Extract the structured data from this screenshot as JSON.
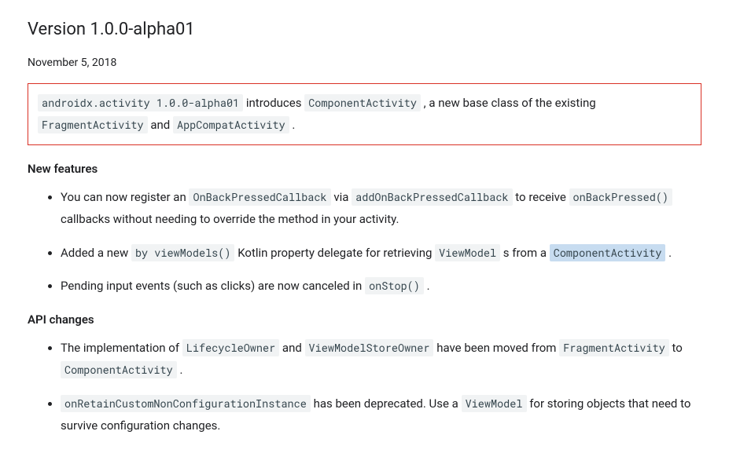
{
  "heading": "Version 1.0.0-alpha01",
  "date": "November 5, 2018",
  "intro": {
    "code1": "androidx.activity 1.0.0-alpha01",
    "text1": " introduces ",
    "code2": "ComponentActivity",
    "text2": " , a new base class of the existing ",
    "code3": "FragmentActivity",
    "text3": " and ",
    "code4": "AppCompatActivity",
    "text4": " ."
  },
  "new_features": {
    "title": "New features",
    "items": [
      {
        "t1": "You can now register an ",
        "c1": "OnBackPressedCallback",
        "t2": " via ",
        "c2": "addOnBackPressedCallback",
        "t3": " to receive ",
        "c3": "onBackPressed()",
        "t4": " callbacks without needing to override the method in your activity."
      },
      {
        "t1": "Added a new ",
        "c1": "by viewModels()",
        "t2": " Kotlin property delegate for retrieving ",
        "c2": "ViewModel",
        "t3": " s from a ",
        "c3": "ComponentActivity",
        "t4": " ."
      },
      {
        "t1": "Pending input events (such as clicks) are now canceled in ",
        "c1": "onStop()",
        "t2": " ."
      }
    ]
  },
  "api_changes": {
    "title": "API changes",
    "items": [
      {
        "t1": "The implementation of ",
        "c1": "LifecycleOwner",
        "t2": " and ",
        "c2": "ViewModelStoreOwner",
        "t3": " have been moved from ",
        "c3": "FragmentActivity",
        "t4": " to ",
        "c4": "ComponentActivity",
        "t5": " ."
      },
      {
        "c1": "onRetainCustomNonConfigurationInstance",
        "t1": " has been deprecated. Use a ",
        "c2": "ViewModel",
        "t2": " for storing objects that need to survive configuration changes."
      }
    ]
  }
}
